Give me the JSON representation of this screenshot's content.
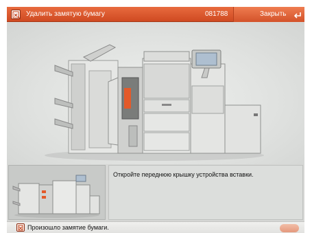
{
  "header": {
    "title": "Удалить замятую бумагу",
    "counter": "081788",
    "close_label": "Закрыть",
    "accent_color": "#d9532a"
  },
  "main": {
    "illustration": "printer-front-cover-open",
    "highlight_color": "#e35a2a"
  },
  "instruction": {
    "text": "Откройте переднюю крышку устройства вставки."
  },
  "status": {
    "text": "Произошло замятие бумаги.",
    "icon": "paper-jam-icon"
  }
}
